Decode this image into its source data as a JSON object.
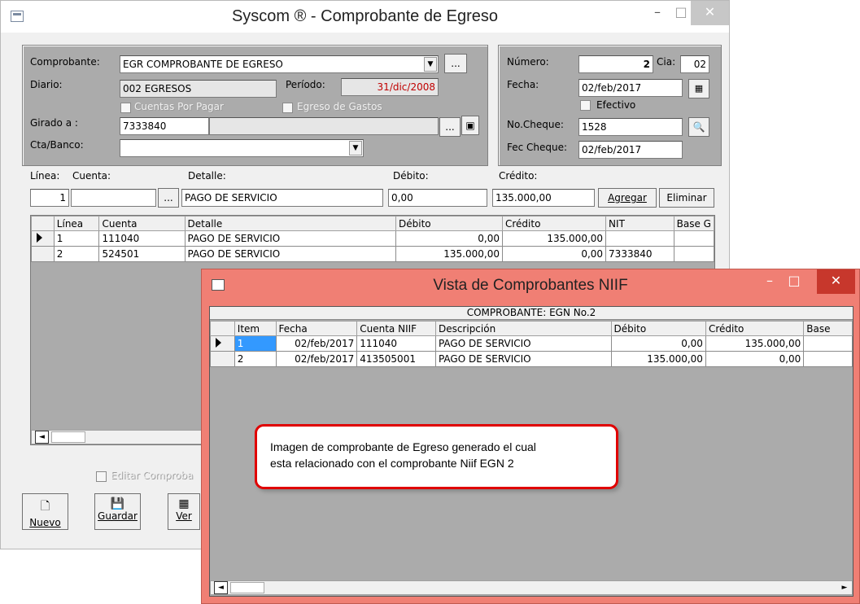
{
  "main_window": {
    "title": "Syscom ® - Comprobante de Egreso",
    "minimize_glyph": "–",
    "maximize_glyph": "□",
    "close_glyph": "✕"
  },
  "header": {
    "comprobante_label": "Comprobante:",
    "comprobante_value": "EGR COMPROBANTE DE EGRESO",
    "diario_label": "Diario:",
    "diario_value": "002 EGRESOS",
    "periodo_label": "Período:",
    "periodo_value": "31/dic/2008",
    "cuentas_por_pagar_label": "Cuentas Por Pagar",
    "egreso_gastos_label": "Egreso de Gastos",
    "girado_label": "Girado a :",
    "girado_value": "7333840",
    "girado_name_value": "",
    "cta_banco_label": "Cta/Banco:",
    "cta_banco_value": "",
    "ellipsis": "...",
    "dropdown_arrow": "▼"
  },
  "right_panel": {
    "numero_label": "Número:",
    "numero_value": "2",
    "cia_label": "Cia:",
    "cia_value": "02",
    "fecha_label": "Fecha:",
    "fecha_value": "02/feb/2017",
    "efectivo_label": "Efectivo",
    "no_cheque_label": "No.Cheque:",
    "no_cheque_value": "1528",
    "fec_cheque_label": "Fec Cheque:",
    "fec_cheque_value": "02/feb/2017"
  },
  "entry": {
    "linea_label": "Línea:",
    "cuenta_label": "Cuenta:",
    "detalle_label": "Detalle:",
    "debito_label": "Débito:",
    "credito_label": "Crédito:",
    "linea_value": "1",
    "cuenta_value": "",
    "detalle_value": "PAGO DE SERVICIO",
    "debito_value": "0,00",
    "credito_value": "135.000,00",
    "agregar_label": "Agregar",
    "eliminar_label": "Eliminar"
  },
  "lines_table": {
    "columns": [
      "Línea",
      "Cuenta",
      "Detalle",
      "Débito",
      "Crédito",
      "NIT",
      "Base G"
    ],
    "rows": [
      [
        "1",
        "111040",
        "PAGO DE SERVICIO",
        "0,00",
        "135.000,00",
        "",
        ""
      ],
      [
        "2",
        "524501",
        "PAGO DE SERVICIO",
        "135.000,00",
        "0,00",
        "7333840",
        ""
      ]
    ]
  },
  "bottom": {
    "editar_label": "Editar Comproba",
    "nuevo_label": "Nuevo",
    "guardar_label": "Guardar",
    "ver_label": "Ver",
    "scroll_left": "◄"
  },
  "niif_window": {
    "title": "Vista de Comprobantes NIIF",
    "minimize_glyph": "–",
    "maximize_glyph": "□",
    "close_glyph": "✕",
    "caption": "COMPROBANTE: EGN No.2",
    "columns": [
      "Item",
      "Fecha",
      "Cuenta NIIF",
      "Descripción",
      "Débito",
      "Crédito",
      "Base"
    ],
    "rows": [
      [
        "1",
        "02/feb/2017",
        "111040",
        "PAGO DE SERVICIO",
        "0,00",
        "135.000,00",
        ""
      ],
      [
        "2",
        "02/feb/2017",
        "413505001",
        "PAGO DE SERVICIO",
        "135.000,00",
        "0,00",
        ""
      ]
    ],
    "scroll_left": "◄",
    "scroll_right": "►"
  },
  "callout": {
    "line1": "Imagen de comprobante de Egreso generado el cual",
    "line2": "esta relacionado con el comprobante Niif EGN 2"
  },
  "colors": {
    "niif_titlebar": "#f07f74",
    "callout_border": "#e00000",
    "periodo_text": "#c00000"
  }
}
